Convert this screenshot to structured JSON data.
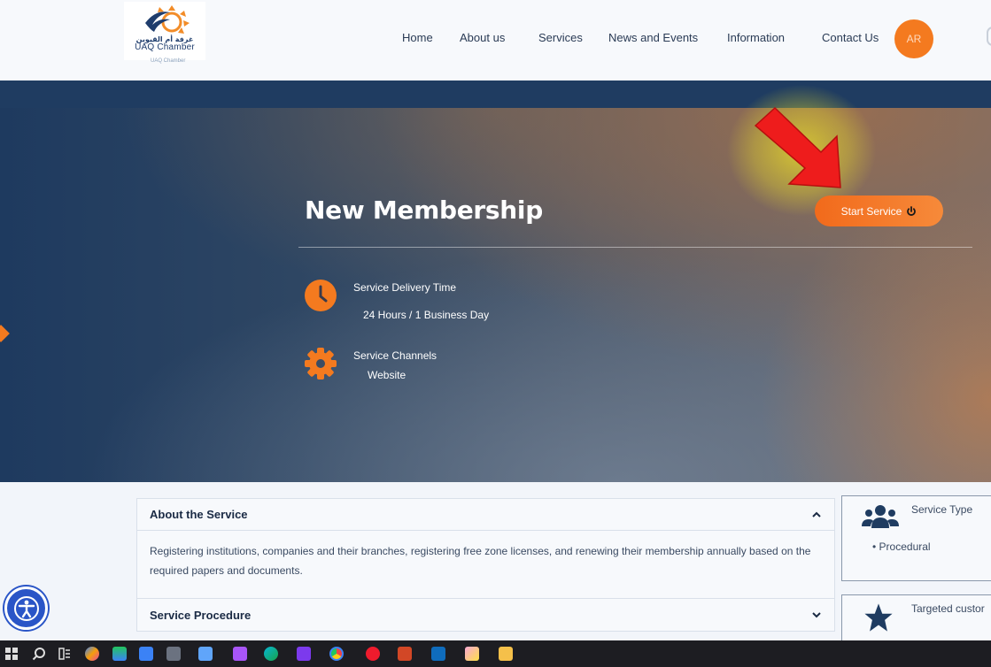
{
  "header": {
    "logo": {
      "arabic_name": "غرفة أم القيوين",
      "english_name": "UAQ Chamber",
      "sub_text": "UAQ Chamber"
    },
    "nav": [
      {
        "label": "Home"
      },
      {
        "label": "About us"
      },
      {
        "label": "Services"
      },
      {
        "label": "News and Events"
      },
      {
        "label": "Information"
      },
      {
        "label": "Contact Us"
      }
    ],
    "language_button": "AR"
  },
  "hero": {
    "title": "New Membership",
    "start_button": "Start Service",
    "delivery_time": {
      "label": "Service Delivery Time",
      "value": "24 Hours / 1 Business Day",
      "icon": "clock-icon"
    },
    "channels": {
      "label": "Service Channels",
      "value": "Website",
      "icon": "gear-icon"
    }
  },
  "accordion": [
    {
      "title": "About the Service",
      "expanded": true,
      "body": "Registering institutions, companies and their branches, registering free zone licenses, and renewing their membership annually based on the required papers and documents."
    },
    {
      "title": "Service Procedure",
      "expanded": false
    }
  ],
  "side_cards": [
    {
      "title": "Service Type",
      "icon": "users-icon",
      "items": [
        "Procedural"
      ]
    },
    {
      "title": "Targeted custor",
      "icon": "star-icon"
    }
  ],
  "colors": {
    "accent": "#f47a1f",
    "navy": "#1f3c61",
    "highlight_arrow": "#ee1c1c",
    "accessibility_blue": "#2a55c7"
  },
  "taskbar": {
    "icons": [
      "windows-start-icon",
      "search-icon",
      "task-view-icon",
      "copilot-icon",
      "app-icon",
      "calculator-icon",
      "app-icon",
      "visual-studio-icon",
      "edge-icon",
      "visual-studio-icon",
      "chrome-icon",
      "opera-icon",
      "powerpoint-icon",
      "outlook-icon",
      "snipping-tool-icon",
      "file-explorer-icon"
    ]
  }
}
